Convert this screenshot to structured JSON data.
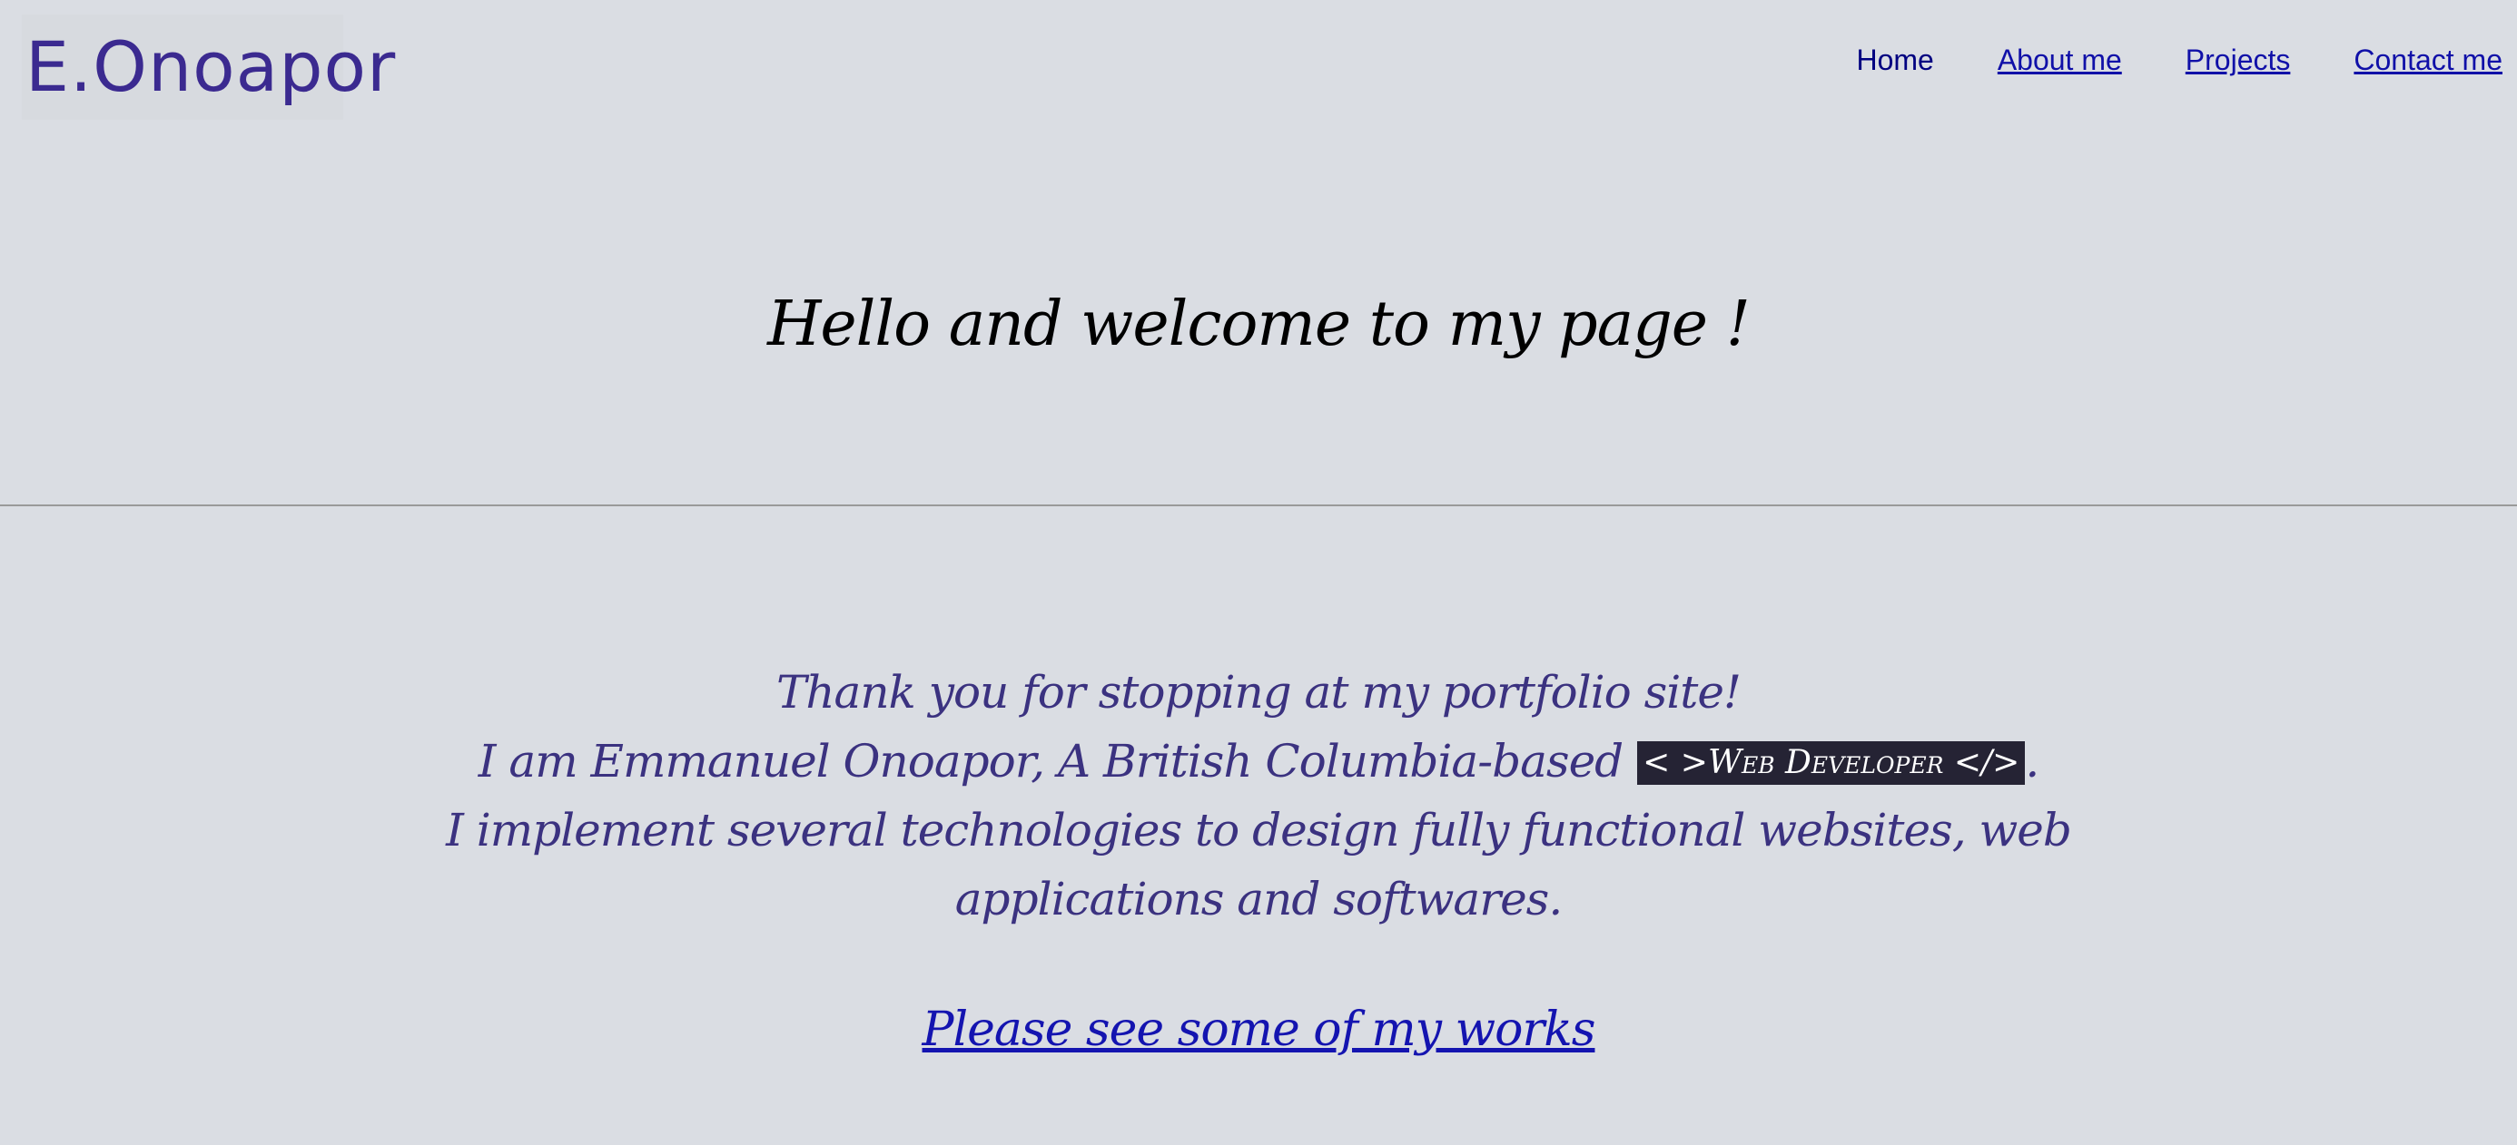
{
  "header": {
    "logo": "E.Onoapor",
    "nav": {
      "home": "Home",
      "about": "About me",
      "projects": "Projects",
      "contact": "Contact me"
    }
  },
  "hero": {
    "title": "Hello and welcome to my page !"
  },
  "intro": {
    "line1": "Thank you for stopping at my portfolio site!",
    "line2_prefix": "I am Emmanuel Onoapor, A British Columbia-based",
    "badge": "< >Web Developer </>",
    "line2_suffix": ".",
    "line3": "I implement several technologies to design fully functional websites, web applications and softwares."
  },
  "cta": {
    "label": "Please see some of my works"
  },
  "colors": {
    "background": "#dadde3",
    "logo": "#3b2a90",
    "link": "#1010a8",
    "intro_text": "#3b3280",
    "badge_bg": "#252334"
  }
}
